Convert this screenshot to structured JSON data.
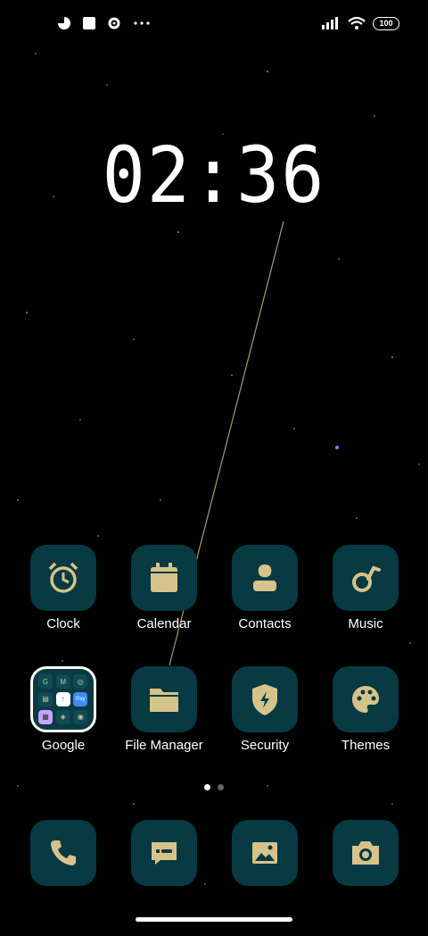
{
  "status_bar": {
    "left_icons": [
      "pie-status-icon",
      "square-status-icon",
      "settings-status-icon",
      "more-dots-icon"
    ],
    "right_icons": [
      "signal-icon",
      "wifi-icon",
      "battery-icon"
    ],
    "battery_level": "100"
  },
  "clock_widget": {
    "time": "02:36"
  },
  "apps": [
    {
      "label": "Clock",
      "icon": "alarm-clock-icon"
    },
    {
      "label": "Calendar",
      "icon": "calendar-icon"
    },
    {
      "label": "Contacts",
      "icon": "contacts-icon"
    },
    {
      "label": "Music",
      "icon": "music-icon"
    },
    {
      "label": "Google",
      "icon": "google-folder-icon"
    },
    {
      "label": "File Manager",
      "icon": "folder-icon"
    },
    {
      "label": "Security",
      "icon": "shield-bolt-icon"
    },
    {
      "label": "Themes",
      "icon": "palette-icon"
    }
  ],
  "folder": {
    "mini_icons": [
      "G",
      "M",
      "◎",
      "▤",
      "↑",
      "Pay",
      "▦",
      "◈",
      "◉"
    ]
  },
  "page_indicator": {
    "pages": 2,
    "active": 1
  },
  "dock": [
    {
      "icon": "phone-icon"
    },
    {
      "icon": "message-icon"
    },
    {
      "icon": "gallery-icon"
    },
    {
      "icon": "camera-icon"
    }
  ],
  "colors": {
    "tile_bg": "#073a42",
    "icon_gold": "#d6c38a",
    "label": "#ffffff"
  }
}
